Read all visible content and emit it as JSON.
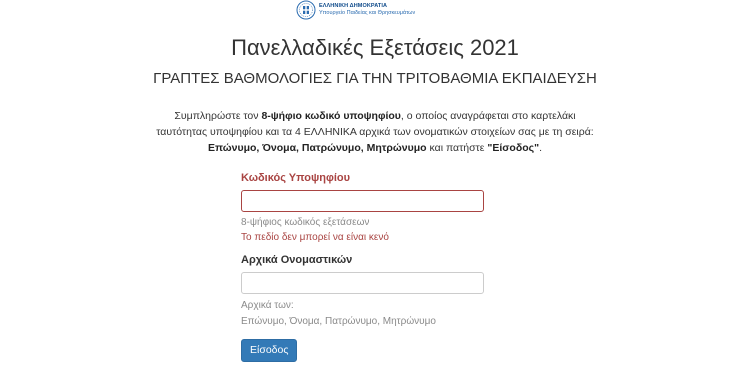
{
  "header": {
    "logo_line1": "ΕΛΛΗΝΙΚΗ ΔΗΜΟΚΡΑΤΙΑ",
    "logo_line2": "Υπουργείο Παιδείας και Θρησκευμάτων",
    "logo_icon": "greek-emblem-icon"
  },
  "main": {
    "title": "Πανελλαδικές Εξετάσεις 2021",
    "subtitle": "ΓΡΑΠΤΕΣ ΒΑΘΜΟΛΟΓΙΕΣ ΓΙΑ ΤΗΝ ΤΡΙΤΟΒΑΘΜΙΑ ΕΚΠΑΙΔΕΥΣΗ",
    "instructions": {
      "p1": "Συμπληρώστε τον ",
      "p1_bold": "8-ψήφιο κωδικό υποψηφίου",
      "p2": ", ο οποίος αναγράφεται στο καρτελάκι",
      "line2": "ταυτότητας υποψηφίου και τα 4 ΕΛΛΗΝΙΚΑ αρχικά των ονοματικών στοιχείων σας με τη σειρά:",
      "line3_bold": "Επώνυμο, Όνομα, Πατρώνυμο, Μητρώνυμο",
      "line3_mid": " και πατήστε ",
      "line3_quote": "\"Είσοδος\"",
      "line3_end": "."
    }
  },
  "form": {
    "code_label": "Κωδικός Υποψηφίου",
    "code_value": "",
    "code_help": "8-ψήφιος κωδικός εξετάσεων",
    "code_error": "Το πεδίο δεν μπορεί να είναι κενό",
    "initials_label": "Αρχικά Ονομαστικών",
    "initials_value": "",
    "initials_help_line1": "Αρχικά των:",
    "initials_help_line2": "Επώνυμο, Όνομα, Πατρώνυμο, Μητρώνυμο",
    "submit_label": "Είσοδος"
  },
  "colors": {
    "error": "#a94442",
    "primary_button": "#337ab7",
    "logo_blue": "#0e4a8a"
  }
}
